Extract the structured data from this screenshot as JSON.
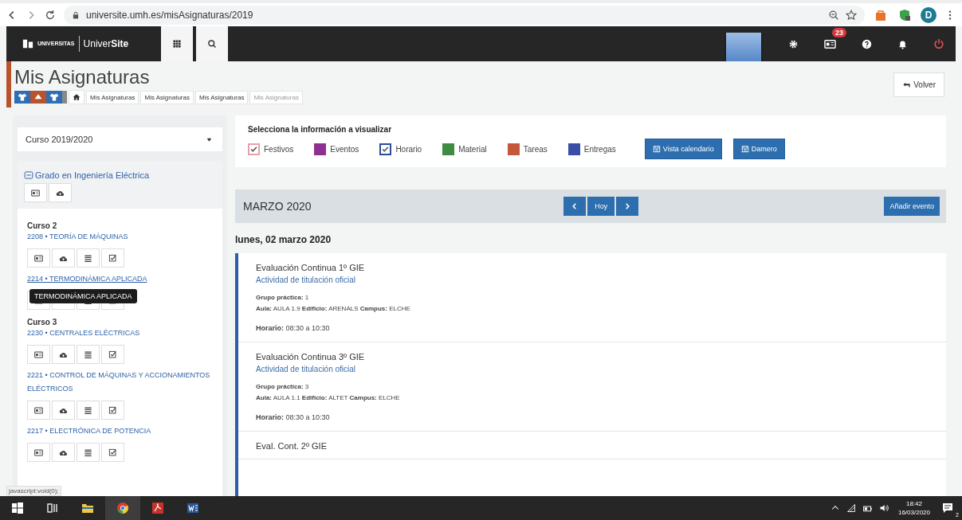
{
  "browser": {
    "url": "universite.umh.es/misAsignaturas/2019",
    "profile": "D"
  },
  "topnav": {
    "logo_text": "UNIVERSITAS",
    "brand": "Univer**Site**",
    "badge": "23"
  },
  "header": {
    "title": "Mis Asignaturas",
    "breadcrumb": [
      {
        "label": "Mis Asignaturas",
        "current": false
      },
      {
        "label": "Mis Asignaturas",
        "current": false
      },
      {
        "label": "Mis Asignaturas",
        "current": false
      },
      {
        "label": "Mis Asignaturas",
        "current": true
      }
    ],
    "back_button": "Volver"
  },
  "sidebar": {
    "course_select": "Curso 2019/2020",
    "group": {
      "label": "Grado en Ingeniería Eléctrica",
      "expanded": true
    },
    "courses": [
      {
        "heading": "Curso 2",
        "subjects": [
          {
            "title": "2208 • TEORÍA DE MÁQUINAS",
            "hovered": false
          },
          {
            "title": "2214 • TERMODINÁMICA APLICADA",
            "hovered": true,
            "tooltip": "TERMODINÁMICA APLICADA"
          }
        ]
      },
      {
        "heading": "Curso 3",
        "subjects": [
          {
            "title": "2230 • CENTRALES ELÉCTRICAS",
            "hovered": false
          },
          {
            "title": "2221 • CONTROL DE MÁQUINAS Y ACCIONAMIENTOS ELÉCTRICOS",
            "hovered": false
          },
          {
            "title": "2217 • ELECTRÓNICA DE POTENCIA",
            "hovered": false
          }
        ]
      }
    ]
  },
  "filters": {
    "heading": "Selecciona la información a visualizar",
    "items": [
      {
        "label": "Festivos",
        "color": "#e4a3ab",
        "checked": true
      },
      {
        "label": "Eventos",
        "color": "#8e2f92",
        "checked": false
      },
      {
        "label": "Horario",
        "color": "#2b4c9b",
        "checked": true
      },
      {
        "label": "Material",
        "color": "#3f8b44",
        "checked": false
      },
      {
        "label": "Tareas",
        "color": "#c4583a",
        "checked": false
      },
      {
        "label": "Entregas",
        "color": "#3a4ea8",
        "checked": false
      }
    ],
    "buttons": [
      "Vista calendario",
      "Damero"
    ]
  },
  "calendar": {
    "month": "MARZO 2020",
    "today_button": "Hoy",
    "add_button": "Añadir evento",
    "day": "lunes, 02 marzo 2020",
    "events": [
      {
        "title": "Evaluación Continua 1º GIE",
        "subtitle": "Actividad de titulación oficial",
        "details": [
          "**Grupo práctica:** 1",
          "**Aula:** AULA 1.9 **Edificio:** ARENALS **Campus:** ELCHE"
        ],
        "schedule": "**Horario:** 08:30  a  10:30"
      },
      {
        "title": "Evaluación Continua 3º GIE",
        "subtitle": "Actividad de titulación oficial",
        "details": [
          "**Grupo práctica:** 3",
          "**Aula:** AULA 1.1 **Edificio:** ALTET **Campus:** ELCHE"
        ],
        "schedule": "**Horario:** 08:30  a  10:30"
      },
      {
        "title": "Eval. Cont. 2º GIE"
      }
    ]
  },
  "status_text": "javascript:void(0);",
  "taskbar": {
    "time": "18:42",
    "date": "16/03/2020",
    "notifications": "2"
  }
}
